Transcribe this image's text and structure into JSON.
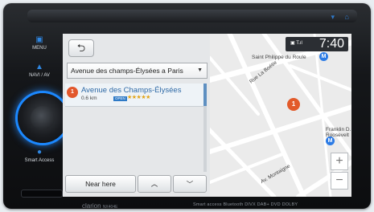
{
  "device": {
    "brand": "clarion",
    "model": "NX404E",
    "features": "Smart access  Bluetooth DIVX DAB+ DVD DOLBY"
  },
  "side_buttons": [
    {
      "label": "MENU",
      "icon": "menu-icon"
    },
    {
      "label": "NAVI / AV",
      "icon": "navi-icon"
    },
    {
      "label": "Smart Access",
      "icon": "microphone-icon"
    }
  ],
  "search": {
    "back_icon": "back-arrow-icon",
    "query": "Avenue des champs-Élysées a Paris",
    "dropdown_icon": "chevron-down-icon"
  },
  "results": [
    {
      "pin": "1",
      "name": "Avenue des Champs-Élysées",
      "distance": "0.6 km",
      "badge": "OPEN",
      "rating": 5
    }
  ],
  "bottom_bar": {
    "near_here": "Near here",
    "up_icon": "chevron-up-icon",
    "down_icon": "chevron-down-icon"
  },
  "status": {
    "signal": "▣ T.ıl",
    "time": "7:40"
  },
  "map": {
    "labels": {
      "church": "Saint Philippe du Roule",
      "boetie": "Rue La Boétie",
      "roosevelt_1": "Franklin D.",
      "roosevelt_2": "Roosevelt",
      "montaigne": "Av. Montaigne"
    },
    "metro_symbol": "M",
    "pin": "1",
    "zoom_in": "+",
    "zoom_out": "−"
  },
  "colors": {
    "accent": "#2f86e0",
    "pin": "#e2572c",
    "glow": "#1b88ff"
  }
}
